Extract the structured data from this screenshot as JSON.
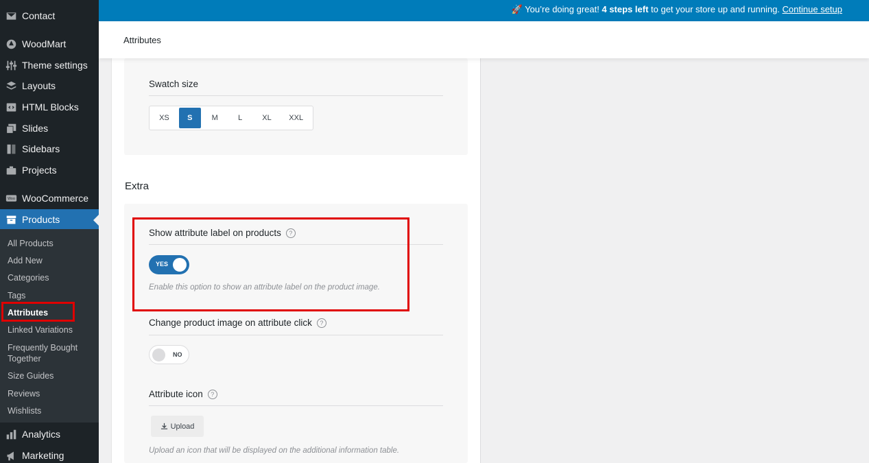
{
  "notice": {
    "emoji": "🚀",
    "text_before": "You’re doing great! ",
    "bold": "4 steps left",
    "text_after": " to get your store up and running. ",
    "link": "Continue setup"
  },
  "header": {
    "title": "Attributes"
  },
  "sidebar": {
    "items": [
      {
        "label": "Contact",
        "icon": "envelope-icon"
      },
      {
        "label": "WoodMart",
        "icon": "woodmart-icon"
      },
      {
        "label": "Theme settings",
        "icon": "sliders-icon"
      },
      {
        "label": "Layouts",
        "icon": "layers-icon"
      },
      {
        "label": "HTML Blocks",
        "icon": "html-block-icon"
      },
      {
        "label": "Slides",
        "icon": "slides-icon"
      },
      {
        "label": "Sidebars",
        "icon": "sidebar-icon"
      },
      {
        "label": "Projects",
        "icon": "briefcase-icon"
      },
      {
        "label": "WooCommerce",
        "icon": "woocommerce-icon"
      },
      {
        "label": "Products",
        "icon": "archive-icon"
      },
      {
        "label": "Analytics",
        "icon": "chart-bar-icon"
      },
      {
        "label": "Marketing",
        "icon": "megaphone-icon"
      }
    ],
    "submenu": [
      "All Products",
      "Add New",
      "Categories",
      "Tags",
      "Attributes",
      "Linked Variations",
      "Frequently Bought Together",
      "Size Guides",
      "Reviews",
      "Wishlists"
    ],
    "current_submenu": "Attributes"
  },
  "swatch": {
    "label": "Swatch size",
    "options": [
      "XS",
      "S",
      "M",
      "L",
      "XL",
      "XXL"
    ],
    "selected": "S"
  },
  "extra": {
    "title": "Extra",
    "show_label": {
      "label": "Show attribute label on products",
      "help": "?",
      "toggle": "YES",
      "description": "Enable this option to show an attribute label on the product image."
    },
    "change_image": {
      "label": "Change product image on attribute click",
      "help": "?",
      "toggle": "NO"
    },
    "attribute_icon": {
      "label": "Attribute icon",
      "help": "?",
      "button": "Upload",
      "description": "Upload an icon that will be displayed on the additional information table."
    }
  },
  "colors": {
    "sidebar_bg": "#1d2327",
    "accent": "#2271b1",
    "notice_bg": "#007cba",
    "highlight": "#e00000"
  }
}
